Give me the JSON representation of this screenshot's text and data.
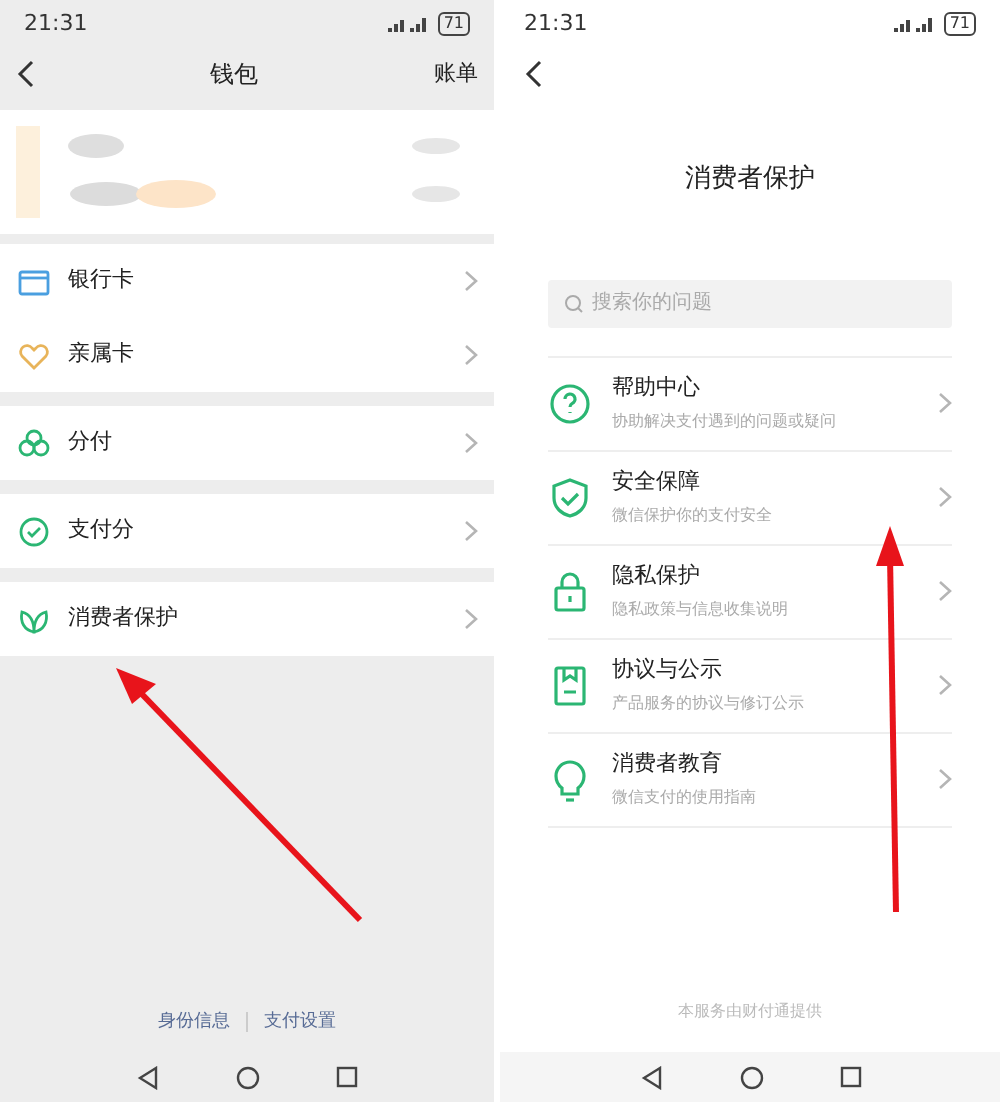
{
  "left_screen": {
    "status_bar": {
      "time": "21:31",
      "battery": "71"
    },
    "header": {
      "title": "钱包",
      "action": "账单"
    },
    "groups": [
      [
        {
          "label": "银行卡",
          "color": "#4a9fe0"
        },
        {
          "label": "亲属卡",
          "color": "#e8b45a"
        }
      ],
      [
        {
          "label": "分付",
          "color": "#2bb673"
        }
      ],
      [
        {
          "label": "支付分",
          "color": "#2bb673"
        }
      ],
      [
        {
          "label": "消费者保护",
          "color": "#2bb673"
        }
      ]
    ],
    "footer_links": [
      "身份信息",
      "支付设置"
    ]
  },
  "right_screen": {
    "status_bar": {
      "time": "21:31",
      "battery": "71"
    },
    "title": "消费者保护",
    "search": {
      "placeholder": "搜索你的问题"
    },
    "items": [
      {
        "title": "帮助中心",
        "subtitle": "协助解决支付遇到的问题或疑问"
      },
      {
        "title": "安全保障",
        "subtitle": "微信保护你的支付安全"
      },
      {
        "title": "隐私保护",
        "subtitle": "隐私政策与信息收集说明"
      },
      {
        "title": "协议与公示",
        "subtitle": "产品服务的协议与修订公示"
      },
      {
        "title": "消费者教育",
        "subtitle": "微信支付的使用指南"
      }
    ],
    "footer": "本服务由财付通提供"
  }
}
